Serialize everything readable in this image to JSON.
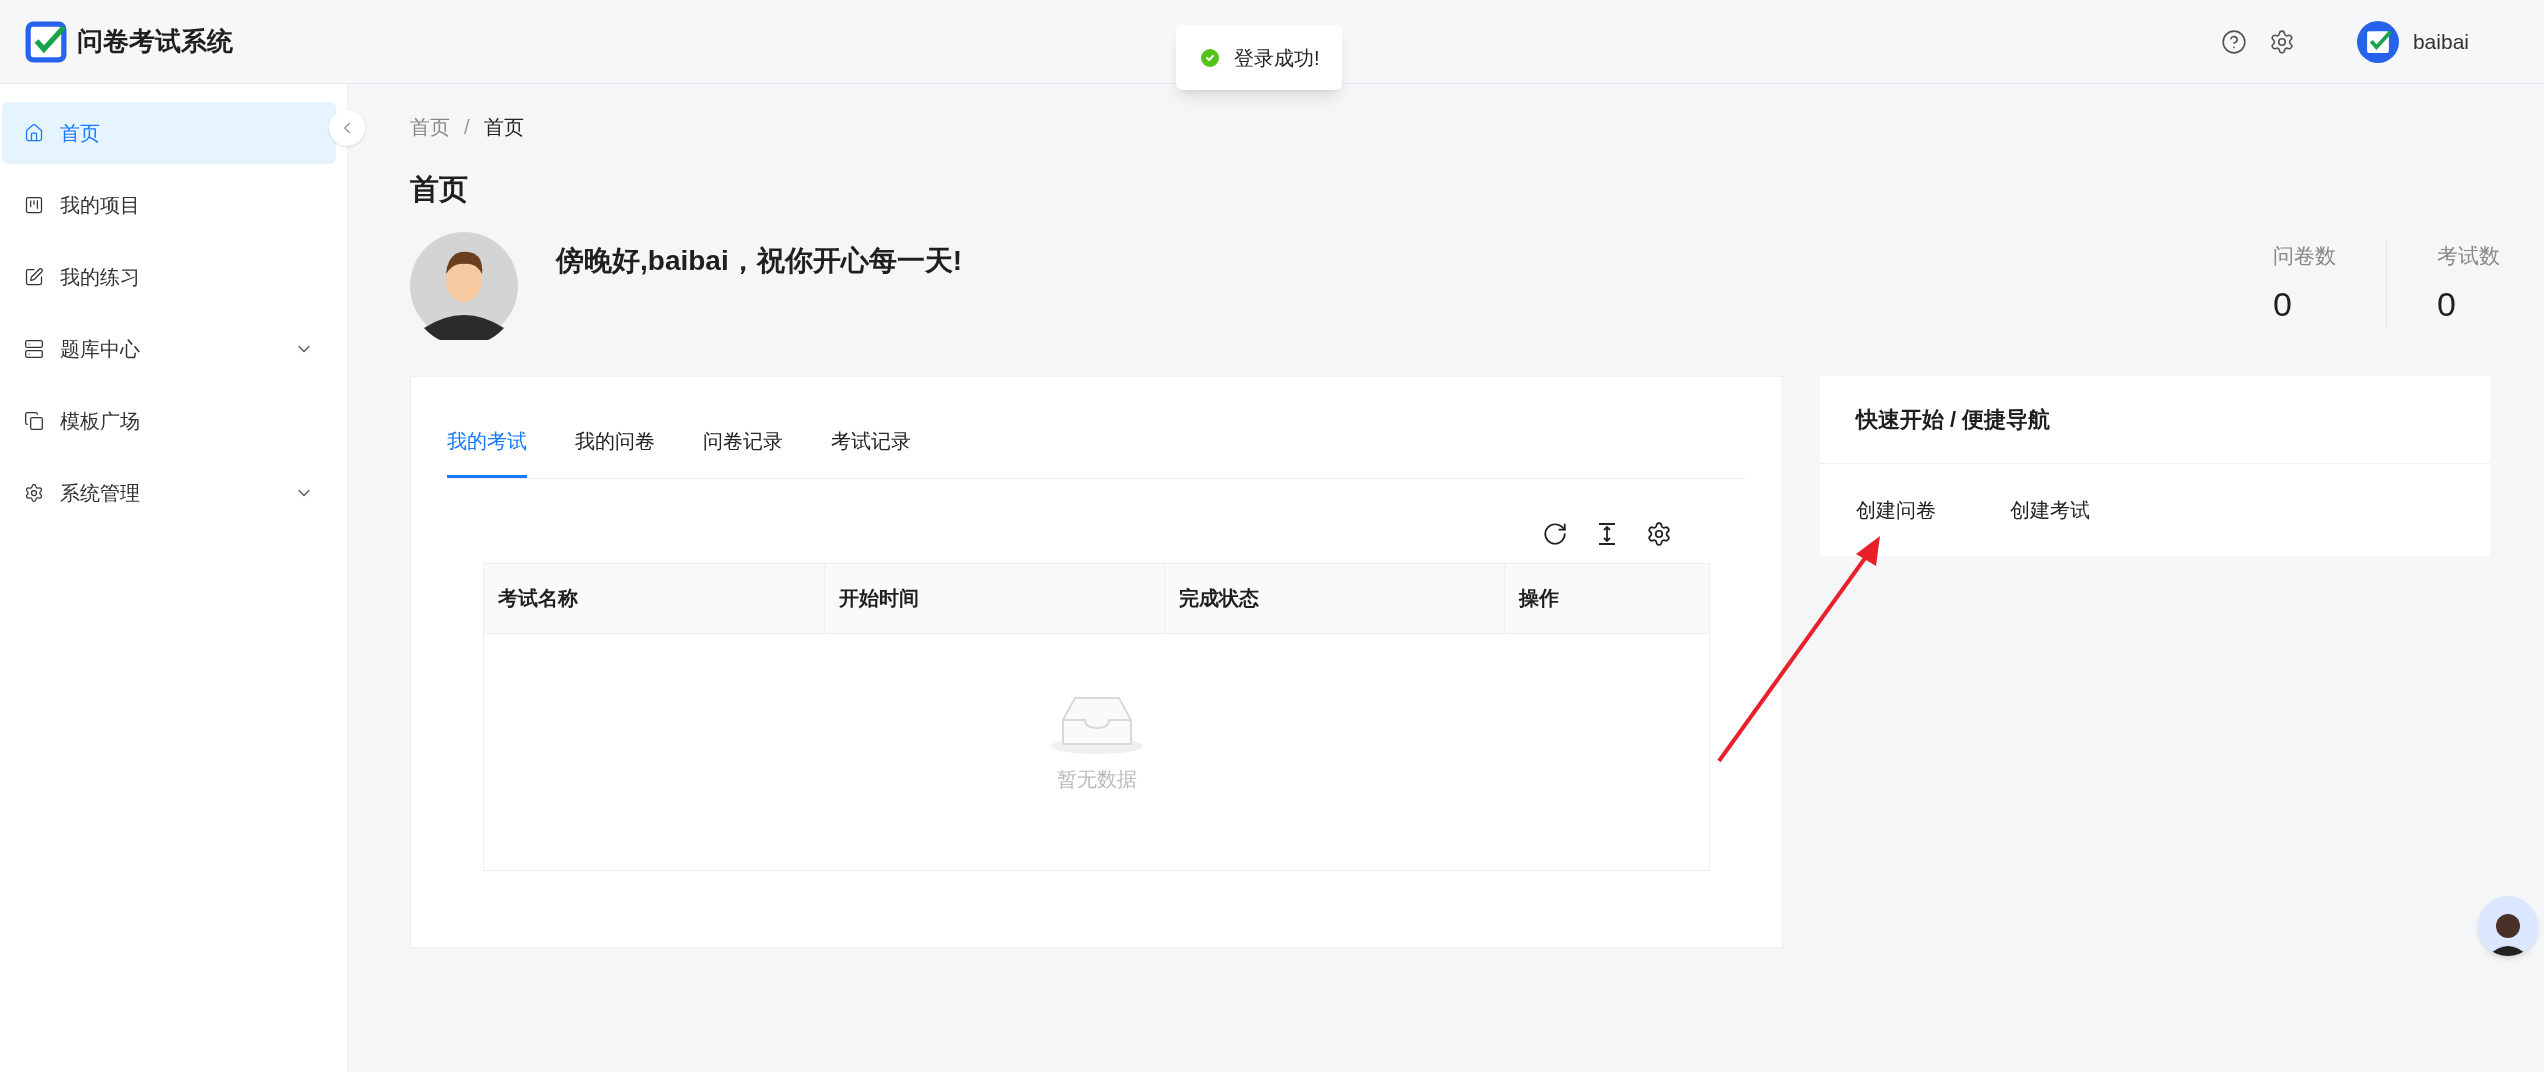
{
  "app": {
    "title": "问卷考试系统"
  },
  "toast": {
    "message": "登录成功!"
  },
  "header": {
    "user": "baibai"
  },
  "sidebar": {
    "items": [
      {
        "label": "首页",
        "selected": true,
        "expandable": false
      },
      {
        "label": "我的项目",
        "selected": false,
        "expandable": false
      },
      {
        "label": "我的练习",
        "selected": false,
        "expandable": false
      },
      {
        "label": "题库中心",
        "selected": false,
        "expandable": true
      },
      {
        "label": "模板广场",
        "selected": false,
        "expandable": false
      },
      {
        "label": "系统管理",
        "selected": false,
        "expandable": true
      }
    ]
  },
  "breadcrumb": {
    "items": [
      "首页",
      "首页"
    ],
    "separator": "/"
  },
  "page_title": "首页",
  "greeting": "傍晚好,baibai，祝你开心每一天!",
  "stats": [
    {
      "label": "问卷数",
      "value": "0"
    },
    {
      "label": "考试数",
      "value": "0"
    }
  ],
  "tabs": [
    {
      "label": "我的考试",
      "selected": true
    },
    {
      "label": "我的问卷",
      "selected": false
    },
    {
      "label": "问卷记录",
      "selected": false
    },
    {
      "label": "考试记录",
      "selected": false
    }
  ],
  "table": {
    "columns": [
      "考试名称",
      "开始时间",
      "完成状态",
      "操作"
    ],
    "empty_text": "暂无数据"
  },
  "quick_nav": {
    "title": "快速开始 / 便捷导航",
    "links": [
      "创建问卷",
      "创建考试"
    ]
  }
}
